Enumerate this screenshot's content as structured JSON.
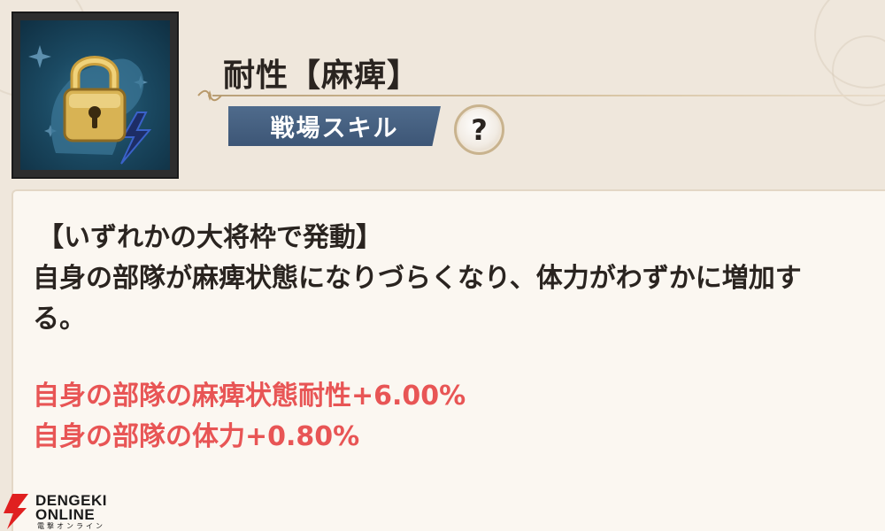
{
  "skill": {
    "name": "耐性【麻痺】",
    "category": "戦場スキル",
    "help_label": "?",
    "icon": "locked-paralysis-skill-icon"
  },
  "description": {
    "condition": "【いずれかの大将枠で発動】",
    "line1": "自身の部隊が麻痺状態になりづらくなり、体力がわずかに増加す",
    "line2": "る。",
    "stats": [
      "自身の部隊の麻痺状態耐性+6.00%",
      "自身の部隊の体力+0.80%"
    ]
  },
  "watermark": {
    "line1": "DENGEKI",
    "line2": "ONLINE",
    "line3": "電撃オンライン"
  },
  "colors": {
    "background": "#efe7dc",
    "panel": "#fbf7f1",
    "badge": "#4a6585",
    "stat_text": "#e85555",
    "lock_gold": "#d8b354",
    "icon_bg": "#1b4a63"
  }
}
